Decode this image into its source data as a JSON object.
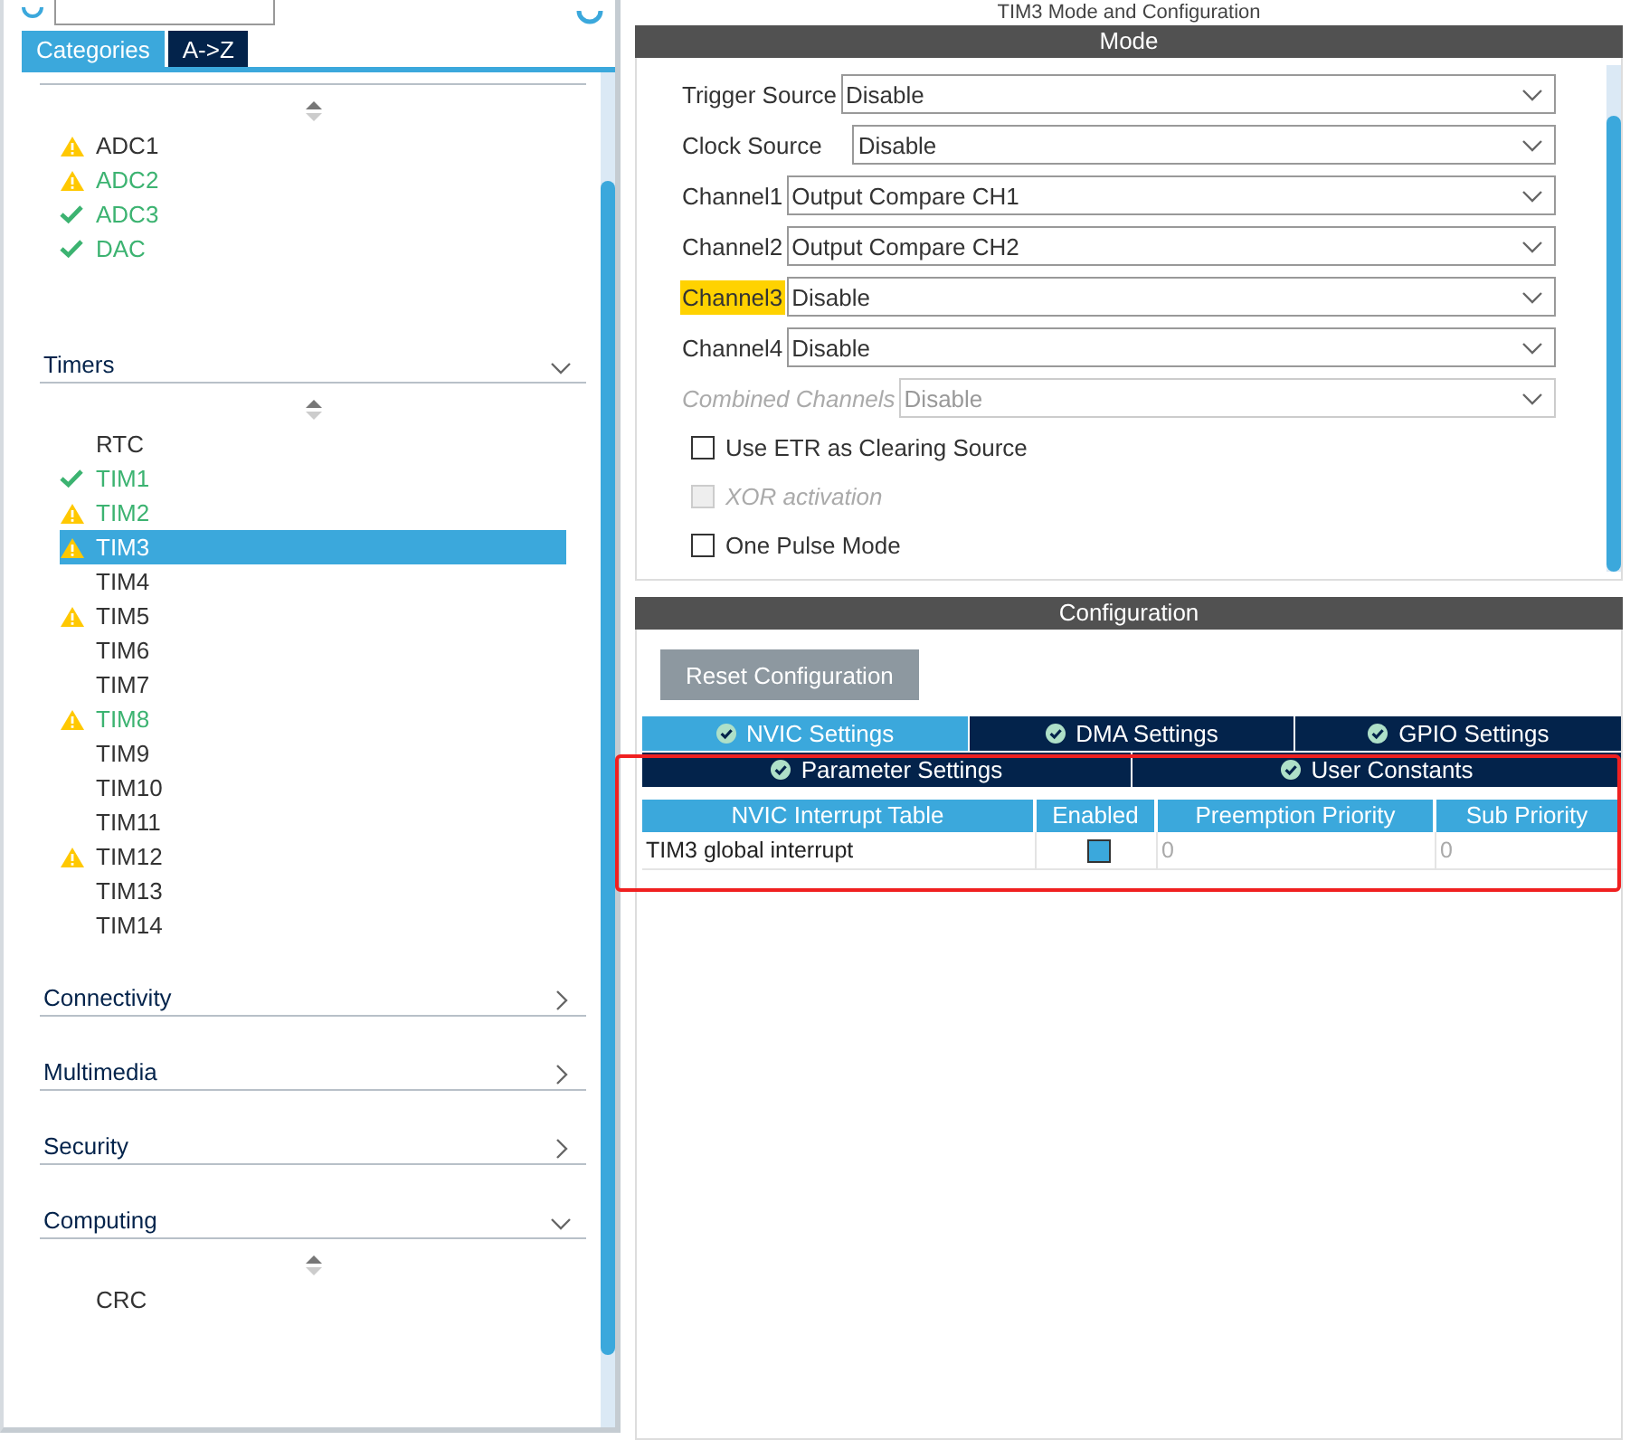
{
  "sidebar": {
    "tabs": [
      {
        "label": "Categories",
        "selected": true
      },
      {
        "label": "A->Z",
        "selected": false
      }
    ],
    "sections": [
      {
        "items": [
          {
            "label": "ADC1",
            "kind": "warning",
            "configured": false
          },
          {
            "label": "ADC2",
            "kind": "warning",
            "configured": true
          },
          {
            "label": "ADC3",
            "kind": "ok",
            "configured": true
          },
          {
            "label": "DAC",
            "kind": "ok",
            "configured": true
          }
        ]
      },
      {
        "title": "Timers",
        "expanded": true,
        "items": [
          {
            "label": "RTC",
            "kind": "plain",
            "configured": false,
            "selected": false
          },
          {
            "label": "TIM1",
            "kind": "ok",
            "configured": true,
            "selected": false
          },
          {
            "label": "TIM2",
            "kind": "warning",
            "configured": true,
            "selected": false
          },
          {
            "label": "TIM3",
            "kind": "warning",
            "configured": false,
            "selected": true
          },
          {
            "label": "TIM4",
            "kind": "plain",
            "configured": false,
            "selected": false
          },
          {
            "label": "TIM5",
            "kind": "warning",
            "configured": false,
            "selected": false
          },
          {
            "label": "TIM6",
            "kind": "plain",
            "configured": false,
            "selected": false
          },
          {
            "label": "TIM7",
            "kind": "plain",
            "configured": false,
            "selected": false
          },
          {
            "label": "TIM8",
            "kind": "warning",
            "configured": true,
            "selected": false
          },
          {
            "label": "TIM9",
            "kind": "plain",
            "configured": false,
            "selected": false
          },
          {
            "label": "TIM10",
            "kind": "plain",
            "configured": false,
            "selected": false
          },
          {
            "label": "TIM11",
            "kind": "plain",
            "configured": false,
            "selected": false
          },
          {
            "label": "TIM12",
            "kind": "warning",
            "configured": false,
            "selected": false
          },
          {
            "label": "TIM13",
            "kind": "plain",
            "configured": false,
            "selected": false
          },
          {
            "label": "TIM14",
            "kind": "plain",
            "configured": false,
            "selected": false
          }
        ]
      },
      {
        "title": "Connectivity",
        "expanded": false
      },
      {
        "title": "Multimedia",
        "expanded": false
      },
      {
        "title": "Security",
        "expanded": false
      },
      {
        "title": "Computing",
        "expanded": true,
        "items": [
          {
            "label": "CRC",
            "kind": "plain",
            "configured": false,
            "selected": false
          }
        ]
      }
    ]
  },
  "panel_title": "TIM3 Mode and Configuration",
  "mode": {
    "title": "Mode",
    "fields": [
      {
        "kind": "select",
        "label": "Trigger Source",
        "value": "Disable",
        "highlighted": false,
        "disabled": false
      },
      {
        "kind": "select",
        "label": "Clock Source",
        "value": "Disable",
        "highlighted": false,
        "disabled": false
      },
      {
        "kind": "select",
        "label": "Channel1",
        "value": "Output Compare CH1",
        "highlighted": false,
        "disabled": false
      },
      {
        "kind": "select",
        "label": "Channel2",
        "value": "Output Compare CH2",
        "highlighted": false,
        "disabled": false
      },
      {
        "kind": "select",
        "label": "Channel3",
        "value": "Disable",
        "highlighted": true,
        "disabled": false
      },
      {
        "kind": "select",
        "label": "Channel4",
        "value": "Disable",
        "highlighted": false,
        "disabled": false
      },
      {
        "kind": "select",
        "label": "Combined Channels",
        "value": "Disable",
        "highlighted": false,
        "disabled": true
      },
      {
        "kind": "checkbox",
        "label": "Use ETR as Clearing Source",
        "checked": false,
        "disabled": false
      },
      {
        "kind": "checkbox",
        "label": "XOR activation",
        "checked": false,
        "disabled": true
      },
      {
        "kind": "checkbox",
        "label": "One Pulse Mode",
        "checked": false,
        "disabled": false
      }
    ]
  },
  "configuration": {
    "title": "Configuration",
    "reset_button": "Reset Configuration",
    "tabs": [
      [
        {
          "label": "NVIC Settings",
          "selected": true
        },
        {
          "label": "DMA Settings",
          "selected": false
        },
        {
          "label": "GPIO Settings",
          "selected": false
        }
      ],
      [
        {
          "label": "Parameter Settings",
          "selected": false
        },
        {
          "label": "User Constants",
          "selected": false
        }
      ]
    ],
    "table": {
      "columns": [
        "NVIC Interrupt Table",
        "Enabled",
        "Preemption Priority",
        "Sub Priority"
      ],
      "rows": [
        {
          "name": "TIM3 global interrupt",
          "enabled": true,
          "preemption_priority": "0",
          "sub_priority": "0"
        }
      ]
    }
  }
}
